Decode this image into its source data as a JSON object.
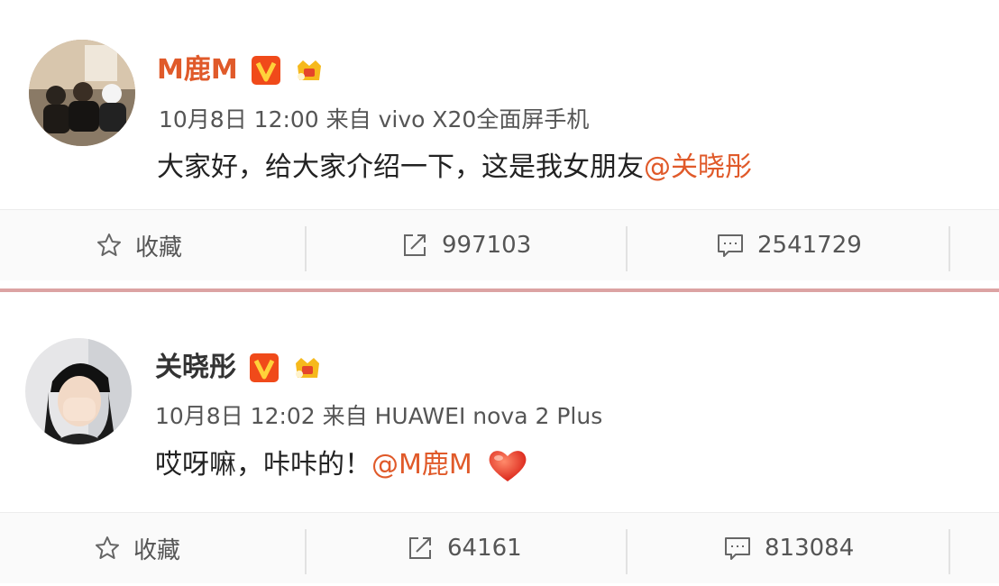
{
  "posts": [
    {
      "username": "M鹿M",
      "meta": "10月8日 12:00 来自 vivo X20全面屏手机",
      "content_text": "大家好，给大家介绍一下，这是我女朋友",
      "mention": "@关晓彤",
      "actions": {
        "favorite_label": "收藏",
        "share_count": "997103",
        "comment_count": "2541729"
      },
      "icons": [
        "verified-v-icon",
        "member-crown-icon",
        "star-icon",
        "share-icon",
        "comment-icon"
      ]
    },
    {
      "username": "关晓彤",
      "meta": "10月8日 12:02 来自 HUAWEI nova 2 Plus",
      "content_text": "哎呀嘛，咔咔的！",
      "mention": "@M鹿M",
      "actions": {
        "favorite_label": "收藏",
        "share_count": "64161",
        "comment_count": "813084"
      },
      "icons": [
        "verified-v-icon",
        "member-crown-icon",
        "heart-emoji-icon",
        "star-icon",
        "share-icon",
        "comment-icon"
      ]
    }
  ],
  "colors": {
    "accent": "#e05a2a",
    "verified": "#f04a1a",
    "crown": "#f6b91c",
    "divider": "#dca3a3"
  }
}
